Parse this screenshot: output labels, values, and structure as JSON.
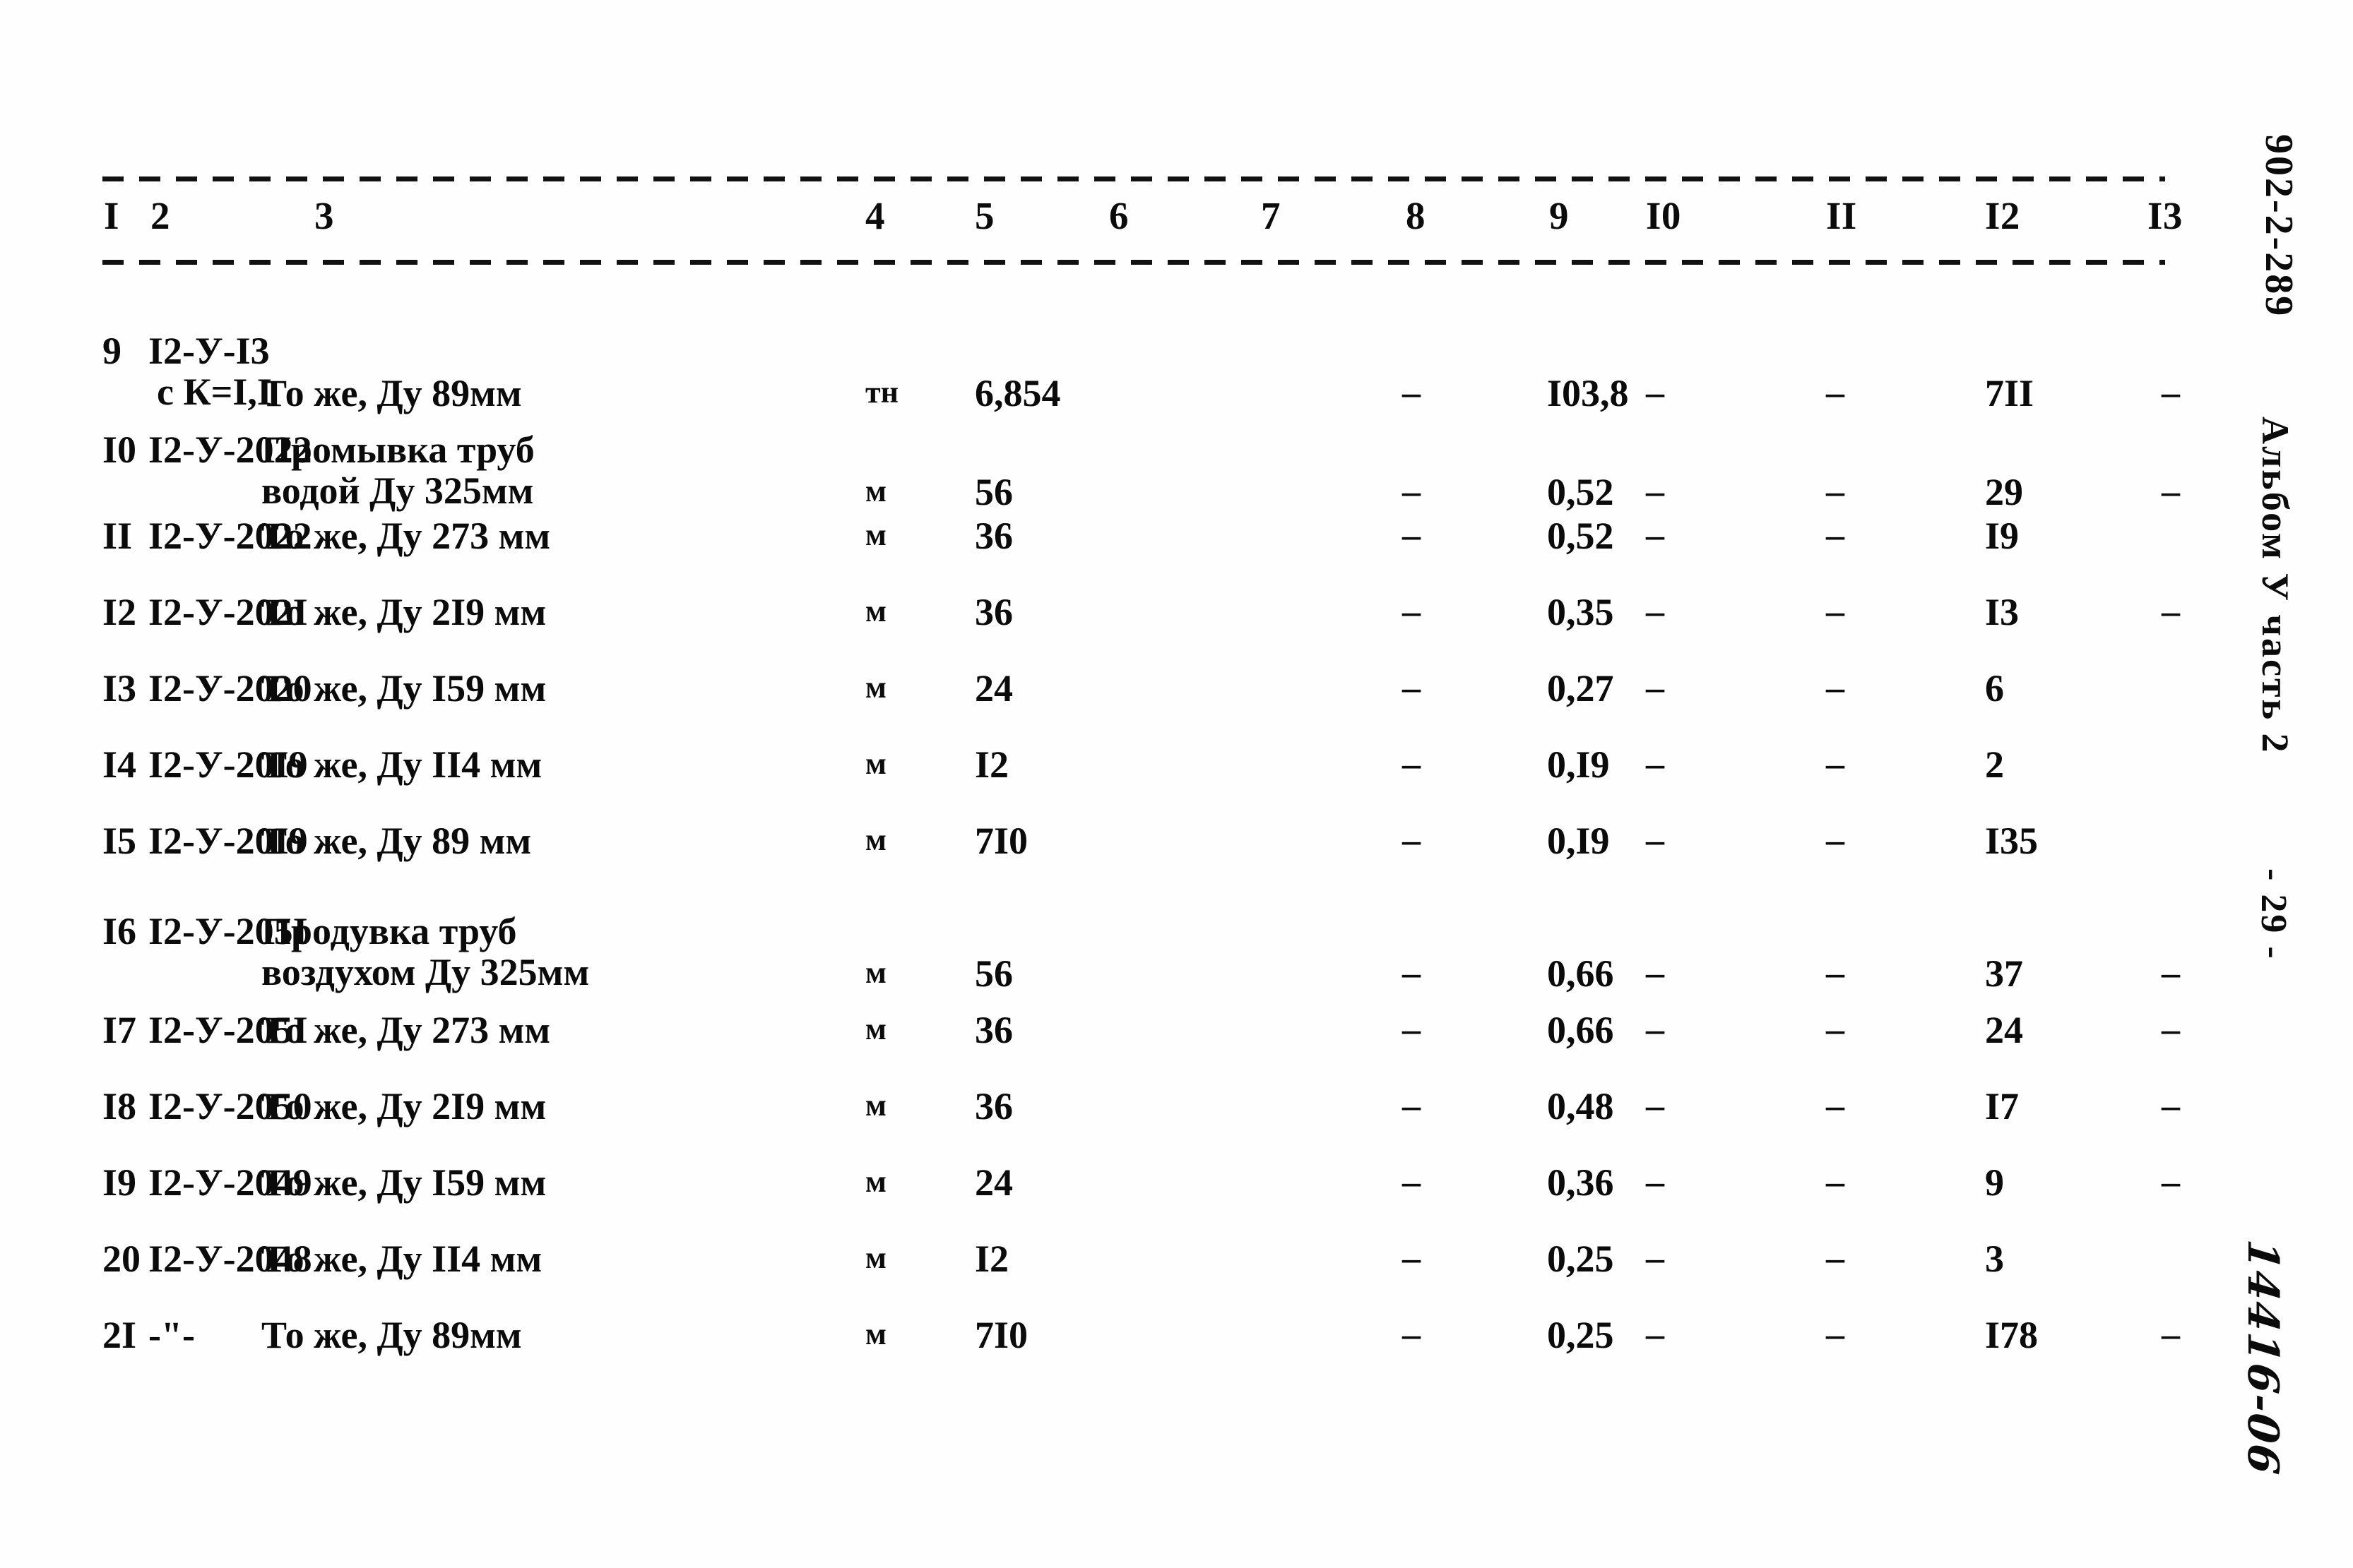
{
  "document": {
    "margin_code": "902-2-289",
    "margin_album": "Альбом У часть 2",
    "margin_page": "- 29 -",
    "margin_handwritten": "14416-06"
  },
  "table": {
    "column_headers": [
      "I",
      "2",
      "3",
      "4",
      "5",
      "6",
      "7",
      "8",
      "9",
      "I0",
      "II",
      "I2",
      "I3"
    ],
    "rows": [
      {
        "c1": "9",
        "c2_line1": "I2-У-I3",
        "c2_line2": "с К=I,I",
        "c3_line1": "То же, Ду 89мм",
        "c3_line2": "",
        "c4": "тн",
        "c5": "6,854",
        "c6": "",
        "c7": "",
        "c8": "–",
        "c9": "I03,8",
        "c10": "–",
        "c11": "–",
        "c12": "7II",
        "c13": "–",
        "two_line": true,
        "desc_second": false
      },
      {
        "c1": "I0",
        "c2_line1": "I2-У-2022",
        "c2_line2": "",
        "c3_line1": "Промывка труб",
        "c3_line2": "водой Ду 325мм",
        "c4": "м",
        "c5": "56",
        "c6": "",
        "c7": "",
        "c8": "–",
        "c9": "0,52",
        "c10": "–",
        "c11": "–",
        "c12": "29",
        "c13": "–",
        "two_line": true,
        "desc_second": true
      },
      {
        "c1": "II",
        "c2_line1": "I2-У-2022",
        "c2_line2": "",
        "c3_line1": "То же, Ду 273 мм",
        "c3_line2": "",
        "c4": "м",
        "c5": "36",
        "c6": "",
        "c7": "",
        "c8": "–",
        "c9": "0,52",
        "c10": "–",
        "c11": "–",
        "c12": "I9",
        "c13": "",
        "two_line": false,
        "desc_second": false
      },
      {
        "c1": "I2",
        "c2_line1": "I2-У-202I",
        "c2_line2": "",
        "c3_line1": "То же, Ду 2I9 мм",
        "c3_line2": "",
        "c4": "м",
        "c5": "36",
        "c6": "",
        "c7": "",
        "c8": "–",
        "c9": "0,35",
        "c10": "–",
        "c11": "–",
        "c12": "I3",
        "c13": "–",
        "two_line": false,
        "desc_second": false
      },
      {
        "c1": "I3",
        "c2_line1": "I2-У-2020",
        "c2_line2": "",
        "c3_line1": "То же, Ду I59 мм",
        "c3_line2": "",
        "c4": "м",
        "c5": "24",
        "c6": "",
        "c7": "",
        "c8": "–",
        "c9": "0,27",
        "c10": "–",
        "c11": "–",
        "c12": "6",
        "c13": "",
        "two_line": false,
        "desc_second": false
      },
      {
        "c1": "I4",
        "c2_line1": "I2-У-20I9",
        "c2_line2": "",
        "c3_line1": "То же, Ду II4 мм",
        "c3_line2": "",
        "c4": "м",
        "c5": "I2",
        "c6": "",
        "c7": "",
        "c8": "–",
        "c9": "0,I9",
        "c10": "–",
        "c11": "–",
        "c12": "2",
        "c13": "",
        "two_line": false,
        "desc_second": false
      },
      {
        "c1": "I5",
        "c2_line1": "I2-У-20I9",
        "c2_line2": "",
        "c3_line1": "То же, Ду 89 мм",
        "c3_line2": "",
        "c4": "м",
        "c5": "7I0",
        "c6": "",
        "c7": "",
        "c8": "–",
        "c9": "0,I9",
        "c10": "–",
        "c11": "–",
        "c12": "I35",
        "c13": "",
        "two_line": false,
        "desc_second": false
      },
      {
        "c1": "I6",
        "c2_line1": "I2-У-205I",
        "c2_line2": "",
        "c3_line1": "Продувка труб",
        "c3_line2": "воздухом Ду 325мм",
        "c4": "м",
        "c5": "56",
        "c6": "",
        "c7": "",
        "c8": "–",
        "c9": "0,66",
        "c10": "–",
        "c11": "–",
        "c12": "37",
        "c13": "–",
        "two_line": true,
        "desc_second": true
      },
      {
        "c1": "I7",
        "c2_line1": "I2-У-205I",
        "c2_line2": "",
        "c3_line1": "То же, Ду 273 мм",
        "c3_line2": "",
        "c4": "м",
        "c5": "36",
        "c6": "",
        "c7": "",
        "c8": "–",
        "c9": "0,66",
        "c10": "–",
        "c11": "–",
        "c12": "24",
        "c13": "–",
        "two_line": false,
        "desc_second": false
      },
      {
        "c1": "I8",
        "c2_line1": "I2-У-2050",
        "c2_line2": "",
        "c3_line1": "То же, Ду 2I9 мм",
        "c3_line2": "",
        "c4": "м",
        "c5": "36",
        "c6": "",
        "c7": "",
        "c8": "–",
        "c9": "0,48",
        "c10": "–",
        "c11": "–",
        "c12": "I7",
        "c13": "–",
        "two_line": false,
        "desc_second": false
      },
      {
        "c1": "I9",
        "c2_line1": "I2-У-2049",
        "c2_line2": "",
        "c3_line1": "То же, Ду I59 мм",
        "c3_line2": "",
        "c4": "м",
        "c5": "24",
        "c6": "",
        "c7": "",
        "c8": "–",
        "c9": "0,36",
        "c10": "–",
        "c11": "–",
        "c12": "9",
        "c13": "–",
        "two_line": false,
        "desc_second": false
      },
      {
        "c1": "20",
        "c2_line1": "I2-У-2048",
        "c2_line2": "",
        "c3_line1": "То же, Ду II4 мм",
        "c3_line2": "",
        "c4": "м",
        "c5": "I2",
        "c6": "",
        "c7": "",
        "c8": "–",
        "c9": "0,25",
        "c10": "–",
        "c11": "–",
        "c12": "3",
        "c13": "",
        "two_line": false,
        "desc_second": false
      },
      {
        "c1": "2I",
        "c2_line1": "-\"-",
        "c2_line2": "",
        "c3_line1": "То же, Ду 89мм",
        "c3_line2": "",
        "c4": "м",
        "c5": "7I0",
        "c6": "",
        "c7": "",
        "c8": "–",
        "c9": "0,25",
        "c10": "–",
        "c11": "–",
        "c12": "I78",
        "c13": "–",
        "two_line": false,
        "desc_second": false
      }
    ]
  }
}
